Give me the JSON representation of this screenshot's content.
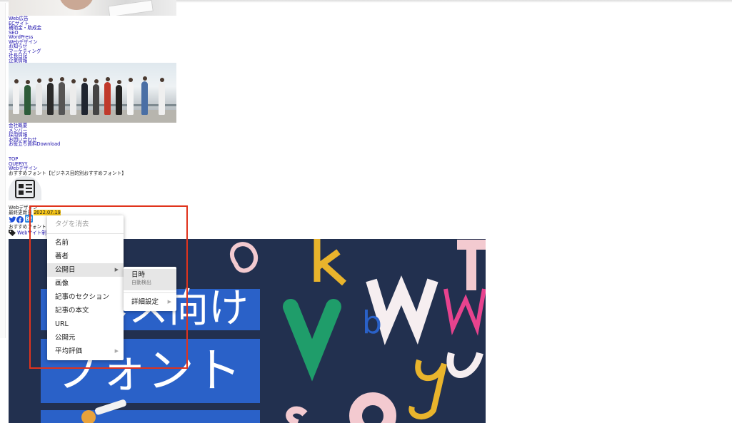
{
  "nav_top": [
    "Web広告",
    "ECサイト",
    "補助金・助成金",
    "SEO",
    "WordPress",
    "Webデザイン",
    "お知らせ",
    "マーケティング",
    "社長日記",
    "企業情報"
  ],
  "nav_company": [
    "会社概要",
    "メンバー",
    "採用情報",
    "お問い合わせ",
    "お役立ち資料Download"
  ],
  "breadcrumb": [
    "TOP",
    "QUERYY",
    "Webデザイン"
  ],
  "article": {
    "title": "おすすめフォント【ビジネス目的別おすすめフォント】",
    "category": "Webデザイン",
    "updated_label": "最終更新日",
    "updated_year": "2022",
    "updated_md": ".07.19",
    "subtitle_prefix": "おすすめフォント",
    "tag_link": "Webサイト制",
    "image_text_line1": "ネス向け",
    "image_text_line2": "フォント"
  },
  "context_menu": {
    "items": [
      {
        "label": "タグを消去",
        "disabled": true
      },
      {
        "label": "名前"
      },
      {
        "label": "著者"
      },
      {
        "label": "公開日",
        "submenu": true,
        "hover": true
      },
      {
        "label": "画像"
      },
      {
        "label": "記事のセクション"
      },
      {
        "label": "記事の本文"
      },
      {
        "label": "URL"
      },
      {
        "label": "公開元"
      },
      {
        "label": "平均評価",
        "submenu": true
      }
    ],
    "submenu": {
      "items": [
        {
          "label": "日時",
          "sublabel": "自動検出"
        },
        {
          "label": "詳細設定",
          "submenu": true
        }
      ]
    },
    "arrow_glyph": "▶"
  },
  "colors": {
    "selection_border": "#e0331c",
    "date_highlight": "#f5c518",
    "link": "#1a0dab",
    "image_bg": "#22304f",
    "image_block": "#2a61c8"
  },
  "icons": [
    "twitter-icon",
    "facebook-icon",
    "hatena-icon",
    "tag-icon",
    "newspaper-icon"
  ]
}
